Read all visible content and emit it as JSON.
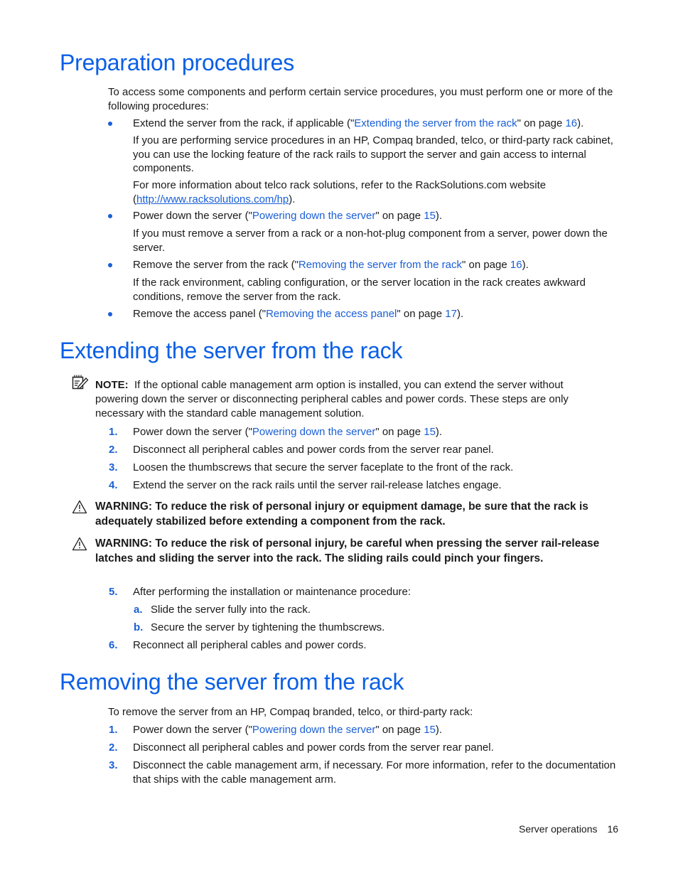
{
  "sections": {
    "prep": {
      "title": "Preparation procedures",
      "intro": "To access some components and perform certain service procedures, you must perform one or more of the following procedures:",
      "items": [
        {
          "pre": "Extend the server from the rack, if applicable (\"",
          "link": "Extending the server from the rack",
          "mid": "\" on page ",
          "page": "16",
          "post": ")."
        },
        {
          "pre": "Power down the server (\"",
          "link": "Powering down the server",
          "mid": "\" on page ",
          "page": "15",
          "post": ")."
        },
        {
          "pre": "Remove the server from the rack (\"",
          "link": "Removing the server from the rack",
          "mid": "\" on page ",
          "page": "16",
          "post": ")."
        },
        {
          "pre": "Remove the access panel (\"",
          "link": "Removing the access panel",
          "mid": "\" on page ",
          "page": "17",
          "post": ")."
        }
      ],
      "item1_para1": "If you are performing service procedures in an HP, Compaq branded, telco, or third-party rack cabinet, you can use the locking feature of the rack rails to support the server and gain access to internal components.",
      "item1_para2_pre": "For more information about telco rack solutions, refer to the RackSolutions.com website (",
      "item1_para2_url": "http://www.racksolutions.com/hp",
      "item1_para2_post": ").",
      "item2_para": "If you must remove a server from a rack or a non-hot-plug component from a server, power down the server.",
      "item3_para": "If the rack environment, cabling configuration, or the server location in the rack creates awkward conditions, remove the server from the rack."
    },
    "extend": {
      "title": "Extending the server from the rack",
      "note_label": "NOTE:",
      "note_text": "If the optional cable management arm option is installed, you can extend the server without powering down the server or disconnecting peripheral cables and power cords. These steps are only necessary with the standard cable management solution.",
      "steps": [
        {
          "num": "1.",
          "pre": "Power down the server (\"",
          "link": "Powering down the server",
          "mid": "\" on page ",
          "page": "15",
          "post": ")."
        },
        {
          "num": "2.",
          "text": "Disconnect all peripheral cables and power cords from the server rear panel."
        },
        {
          "num": "3.",
          "text": "Loosen the thumbscrews that secure the server faceplate to the front of the rack."
        },
        {
          "num": "4.",
          "text": "Extend the server on the rack rails until the server rail-release latches engage."
        },
        {
          "num": "5.",
          "text": "After performing the installation or maintenance procedure:"
        },
        {
          "num": "6.",
          "text": "Reconnect all peripheral cables and power cords."
        }
      ],
      "substeps": [
        {
          "num": "a.",
          "text": "Slide the server fully into the rack."
        },
        {
          "num": "b.",
          "text": "Secure the server by tightening the thumbscrews."
        }
      ],
      "warning1": "WARNING:  To reduce the risk of personal injury or equipment damage, be sure that the rack is adequately stabilized before extending a component from the rack.",
      "warning2": "WARNING:  To reduce the risk of personal injury, be careful when pressing the server rail-release latches and sliding the server into the rack. The sliding rails could pinch your fingers."
    },
    "remove": {
      "title": "Removing the server from the rack",
      "intro": "To remove the server from an HP, Compaq branded, telco, or third-party rack:",
      "steps": [
        {
          "num": "1.",
          "pre": "Power down the server (\"",
          "link": "Powering down the server",
          "mid": "\" on page ",
          "page": "15",
          "post": ")."
        },
        {
          "num": "2.",
          "text": "Disconnect all peripheral cables and power cords from the server rear panel."
        },
        {
          "num": "3.",
          "text": "Disconnect the cable management arm, if necessary. For more information, refer to the documentation that ships with the cable management arm."
        }
      ]
    }
  },
  "footer": {
    "section": "Server operations",
    "page": "16"
  },
  "colors": {
    "heading": "#0a5fe6",
    "link": "#1a5fd6",
    "text": "#1a1a1a"
  }
}
